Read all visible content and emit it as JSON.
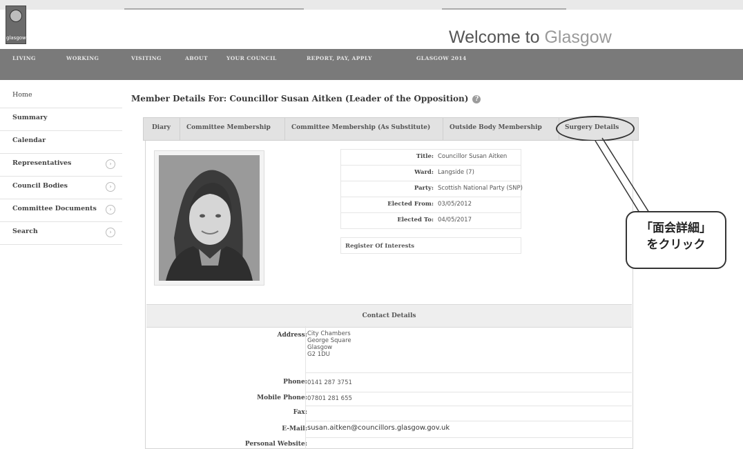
{
  "header": {
    "logo_text": "glasgow",
    "welcome_prefix": "Welcome to ",
    "welcome_highlight": "Glasgow"
  },
  "nav": [
    "LIVING",
    "WORKING",
    "VISITING",
    "ABOUT",
    "YOUR COUNCIL",
    "REPORT, PAY, APPLY",
    "GLASGOW 2014"
  ],
  "sidebar": {
    "items": [
      {
        "label": "Home",
        "arrow": false
      },
      {
        "label": "Summary",
        "arrow": false
      },
      {
        "label": "Calendar",
        "arrow": false
      },
      {
        "label": "Representatives",
        "arrow": true
      },
      {
        "label": "Council Bodies",
        "arrow": true
      },
      {
        "label": "Committee Documents",
        "arrow": true
      },
      {
        "label": "Search",
        "arrow": true
      }
    ]
  },
  "page_title": "Member Details For: Councillor Susan Aitken (Leader of the Opposition)",
  "tabs": [
    "Diary",
    "Committee Membership",
    "Committee Membership (As Substitute)",
    "Outside Body Membership",
    "Surgery Details"
  ],
  "member": {
    "rows": [
      {
        "label": "Title:",
        "value": "Councillor Susan Aitken"
      },
      {
        "label": "Ward:",
        "value": "Langside (7)"
      },
      {
        "label": "Party:",
        "value": "Scottish National Party (SNP)"
      },
      {
        "label": "Elected From:",
        "value": "03/05/2012"
      },
      {
        "label": "Elected To:",
        "value": "04/05/2017"
      }
    ],
    "register_label": "Register Of Interests"
  },
  "contact": {
    "heading": "Contact Details",
    "rows": [
      {
        "label": "Address:",
        "value": "City Chambers\nGeorge Square\nGlasgow\nG2 1DU"
      },
      {
        "label": "Phone:",
        "value": "0141 287 3751"
      },
      {
        "label": "Mobile Phone:",
        "value": "07801 281 655"
      },
      {
        "label": "Fax:",
        "value": ""
      },
      {
        "label": "E-Mail:",
        "value": "susan.aitken@councillors.glasgow.gov.uk"
      },
      {
        "label": "Personal Website:",
        "value": ""
      }
    ]
  },
  "callout": {
    "line1": "「面会詳細」",
    "line2": "をクリック"
  },
  "colors": {
    "nav_bg": "#7a7a7a",
    "tab_bg": "#e2e2e2"
  }
}
